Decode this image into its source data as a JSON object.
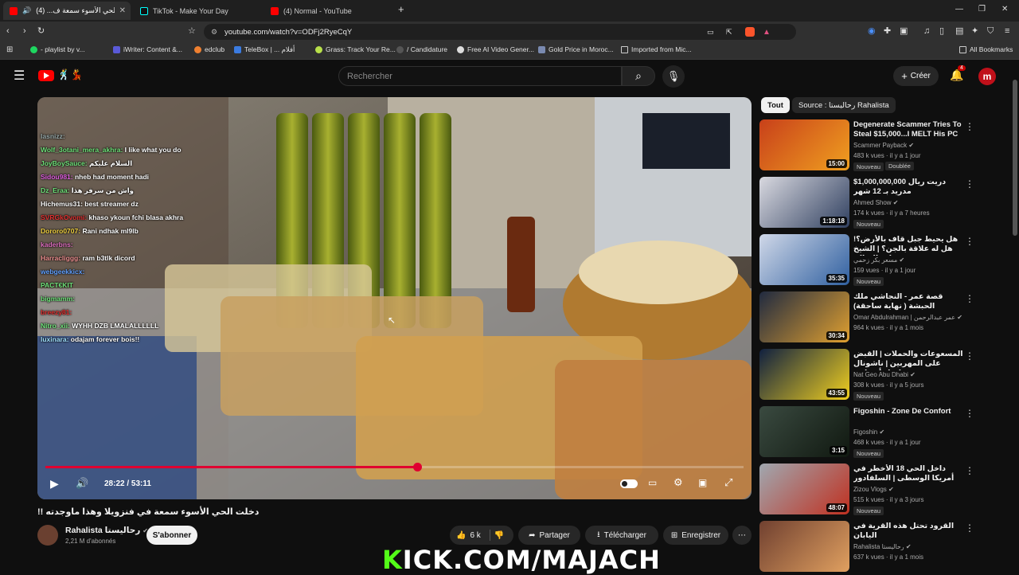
{
  "browser": {
    "tabs": [
      {
        "label": "دخلت الحي الأسوء سمعة ف... (4)",
        "active": true
      },
      {
        "label": "TikTok - Make Your Day",
        "active": false
      },
      {
        "label": "(4) Normal - YouTube",
        "active": false
      }
    ],
    "url": "youtube.com/watch?v=ODFj2RyeCqY",
    "bookmarks": [
      "- playlist by v...",
      "iWriter: Content &...",
      "edclub",
      "TeleBox | ... أفلام",
      "Grass: Track Your Re...",
      "/ Candidature",
      "Free AI Video Gener...",
      "Gold Price in Moroc...",
      "Imported from Mic..."
    ],
    "all_bookmarks": "All Bookmarks"
  },
  "youtube": {
    "search_placeholder": "Rechercher",
    "create_label": "Créer",
    "notif_count": "4"
  },
  "video": {
    "current_time": "28:22 / 53:11",
    "progress": 0.533,
    "chat": [
      {
        "user": "lasnizz:",
        "msg": "",
        "color": "#9aa"
      },
      {
        "user": "Wolf_3otani_mera_akhra:",
        "msg": "I like what you do",
        "color": "#6fe27a"
      },
      {
        "user": "JoyBoySauce:",
        "msg": "السلام عليكم",
        "color": "#6fe27a"
      },
      {
        "user": "Sidou981:",
        "msg": "nheb had moment hadi",
        "color": "#e060e0"
      },
      {
        "user": "Dz_Eraa:",
        "msg": "واش من سرفر هذا",
        "color": "#6fe27a"
      },
      {
        "user": "Hichemus31:",
        "msg": "best streamer dz",
        "color": "#ffffff"
      },
      {
        "user": "SVRGkOvomi:",
        "msg": "khaso ykoun fchi blasa akhra",
        "color": "#e03030"
      },
      {
        "user": "Dororo0707:",
        "msg": "Rani ndhak ml9lb",
        "color": "#f0d040"
      },
      {
        "user": "kaderbns:",
        "msg": "",
        "color": "#e070c0"
      },
      {
        "user": "Harracliggg:",
        "msg": "ram b3tlk dicord",
        "color": "#ee9090"
      },
      {
        "user": "webgeekkicx:",
        "msg": "",
        "color": "#60a0ff"
      },
      {
        "user": "PACT€KIT",
        "msg": "",
        "color": "#6fe27a"
      },
      {
        "user": "bigmamm:",
        "msg": "",
        "color": "#6fe27a"
      },
      {
        "user": "breezy81:",
        "msg": "",
        "color": "#e03030"
      },
      {
        "user": "Nitro_xii:",
        "msg": "WYHH DZB LMALALLLLLL",
        "color": "#6fe27a"
      },
      {
        "user": "luxinara:",
        "msg": "odajam forever bois!!",
        "color": "#a0e0ff"
      }
    ]
  },
  "info": {
    "title": "دخلت الحي الأسوء سمعة في فنزويلا وهذا ماوجدته !!",
    "channel": "Rahalista رحاليستا",
    "subs": "2,21 M d'abonnés",
    "subscribe": "S'abonner",
    "likes": "6 k",
    "share": "Partager",
    "download": "Télécharger",
    "save": "Enregistrer"
  },
  "sidebar": {
    "chips": [
      "Tout",
      "Source : رحاليستا Rahalista"
    ],
    "items": [
      {
        "title": "Degenerate Scammer Tries To Steal $15,000...I MELT His PC",
        "channel": "Scammer Payback",
        "meta": "483 k vues · il y a 1 jour",
        "badge": "Nouveau",
        "badge2": "Doublée",
        "duration": "15:00",
        "c1": "#c8401a",
        "c2": "#f0a020"
      },
      {
        "title": "$1,000,000,000 دريت ريال مدريد بـ 12 شهر",
        "channel": "Ahmed Show",
        "meta": "174 k vues · il y a 7 heures",
        "badge": "Nouveau",
        "badge2": "",
        "duration": "1:18:18",
        "c1": "#d9d9e0",
        "c2": "#304060"
      },
      {
        "title": "هل يحيط جبل قاف بالأرض؟! هل له علاقة بالجن؟ | الشيخ نواف السالم",
        "channel": "مسعر بكر زحمي",
        "meta": "159 vues · il y a 1 jour",
        "badge": "Nouveau",
        "badge2": "",
        "duration": "35:35",
        "c1": "#d0d8e8",
        "c2": "#3060a0"
      },
      {
        "title": "قصة عمر - النجاشي ملك الحبشة ( نهاية ساحقة)",
        "channel": "Omar Abdulrahman | عمر عبدالرحمن",
        "meta": "964 k vues · il y a 1 mois",
        "badge": "",
        "badge2": "",
        "duration": "30:34",
        "c1": "#202a40",
        "c2": "#e0a030"
      },
      {
        "title": "المسعوعات والحملات | القبض على المهربين | ناشونال جيوغرافيك أبوظبي",
        "channel": "Nat Geo Abu Dhabi",
        "meta": "308 k vues · il y a 5 jours",
        "badge": "Nouveau",
        "badge2": "",
        "duration": "43:55",
        "c1": "#102040",
        "c2": "#f0d020"
      },
      {
        "title": "Figoshin - Zone De Confort",
        "channel": "Figoshin",
        "meta": "468 k vues · il y a 1 jour",
        "badge": "Nouveau",
        "badge2": "",
        "duration": "3:15",
        "c1": "#3a4a40",
        "c2": "#101810"
      },
      {
        "title": "داخل الحي 18 الأخطر في أمريكا الوسطى | السلفادور",
        "channel": "Zizou Vlogs",
        "meta": "515 k vues · il y a 3 jours",
        "badge": "Nouveau",
        "badge2": "",
        "duration": "48:07",
        "c1": "#a0a8b0",
        "c2": "#c03020"
      },
      {
        "title": "القرود تحتل هذه القرية في اليابان",
        "channel": "Rahalista رحاليستا",
        "meta": "637 k vues · il y a 1 mois",
        "badge": "",
        "badge2": "",
        "duration": "",
        "c1": "#704030",
        "c2": "#e0a060"
      }
    ]
  },
  "overlay": {
    "kick": "KICK.COM/MAJACH"
  }
}
